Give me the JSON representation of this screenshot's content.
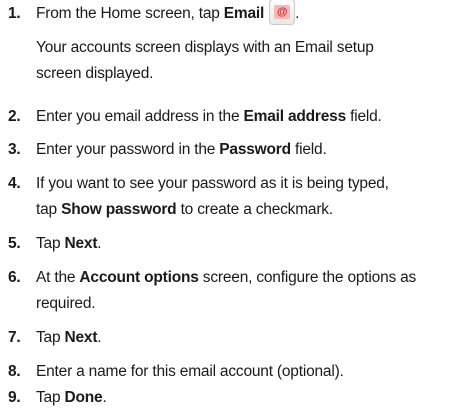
{
  "steps": [
    {
      "number": "1.",
      "lines": [
        {
          "parts": [
            {
              "text": "From the Home screen, tap ",
              "bold": false
            },
            {
              "text": "Email",
              "bold": true
            },
            {
              "icon": "email-app-icon"
            },
            {
              "text": ".",
              "bold": false
            }
          ]
        },
        {
          "parts": [
            {
              "text": "Your accounts screen displays with an Email setup",
              "bold": false
            }
          ]
        },
        {
          "parts": [
            {
              "text": "screen displayed.",
              "bold": false
            }
          ]
        }
      ]
    },
    {
      "number": "2.",
      "lines": [
        {
          "parts": [
            {
              "text": "Enter you email address in the ",
              "bold": false
            },
            {
              "text": "Email address",
              "bold": true
            },
            {
              "text": " field.",
              "bold": false
            }
          ]
        }
      ]
    },
    {
      "number": "3.",
      "lines": [
        {
          "parts": [
            {
              "text": "Enter your password in the ",
              "bold": false
            },
            {
              "text": "Password",
              "bold": true
            },
            {
              "text": " field.",
              "bold": false
            }
          ]
        }
      ]
    },
    {
      "number": "4.",
      "lines": [
        {
          "parts": [
            {
              "text": "If you want to see your password as it is being typed,",
              "bold": false
            }
          ]
        },
        {
          "parts": [
            {
              "text": "tap ",
              "bold": false
            },
            {
              "text": "Show password",
              "bold": true
            },
            {
              "text": " to create a checkmark.",
              "bold": false
            }
          ]
        }
      ]
    },
    {
      "number": "5.",
      "lines": [
        {
          "parts": [
            {
              "text": "Tap ",
              "bold": false
            },
            {
              "text": "Next",
              "bold": true
            },
            {
              "text": ".",
              "bold": false
            }
          ]
        }
      ]
    },
    {
      "number": "6.",
      "lines": [
        {
          "parts": [
            {
              "text": "At the ",
              "bold": false
            },
            {
              "text": "Account options",
              "bold": true
            },
            {
              "text": " screen, configure the options as",
              "bold": false
            }
          ]
        },
        {
          "parts": [
            {
              "text": "required.",
              "bold": false
            }
          ]
        }
      ]
    },
    {
      "number": "7.",
      "lines": [
        {
          "parts": [
            {
              "text": "Tap ",
              "bold": false
            },
            {
              "text": "Next",
              "bold": true
            },
            {
              "text": ".",
              "bold": false
            }
          ]
        }
      ]
    },
    {
      "number": "8.",
      "lines": [
        {
          "parts": [
            {
              "text": "Enter a name for this email account (optional).",
              "bold": false
            }
          ]
        }
      ]
    },
    {
      "number": "9.",
      "lines": [
        {
          "parts": [
            {
              "text": "Tap ",
              "bold": false
            },
            {
              "text": "Done",
              "bold": true
            },
            {
              "text": ".",
              "bold": false
            }
          ]
        }
      ]
    }
  ]
}
